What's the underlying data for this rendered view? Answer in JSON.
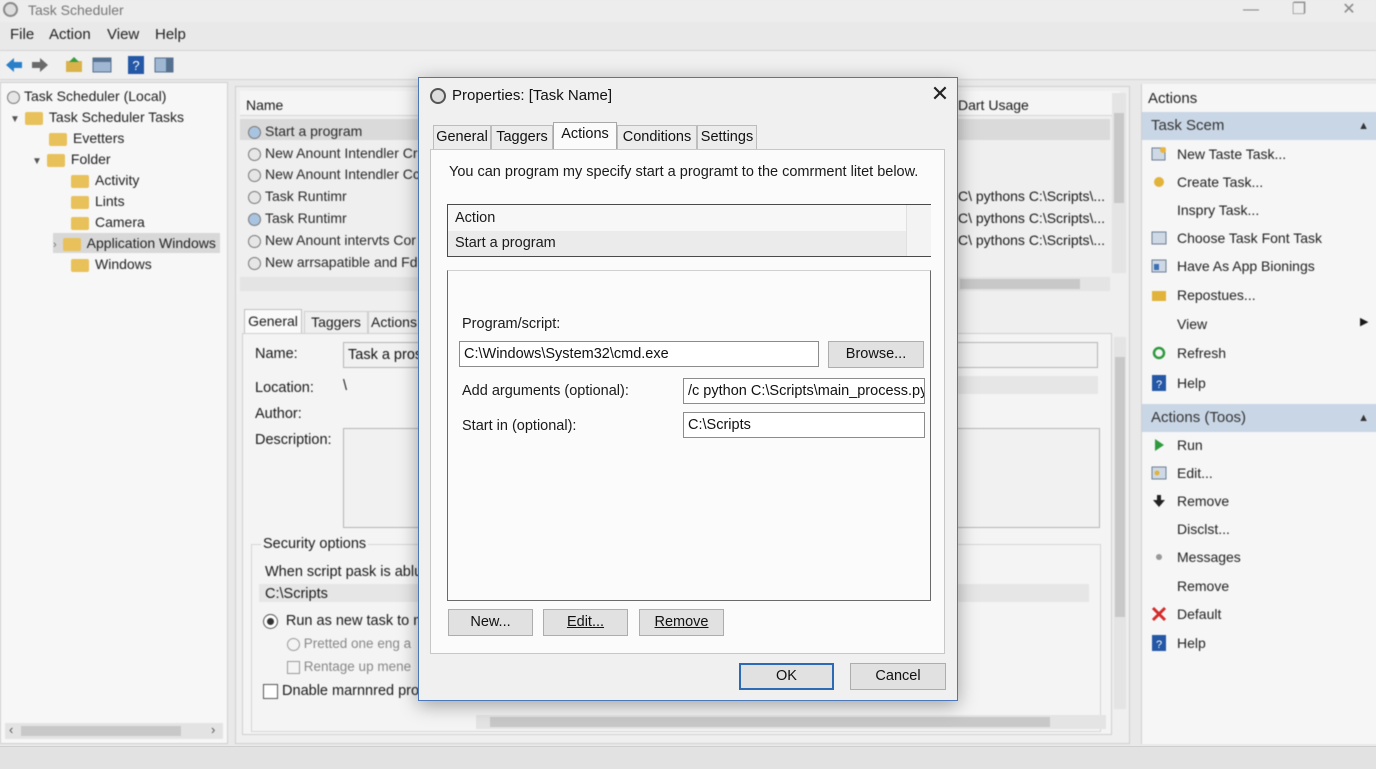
{
  "window": {
    "title": "Task Scheduler",
    "controls": [
      "—",
      "❐",
      "✕"
    ]
  },
  "menu": [
    "File",
    "Action",
    "View",
    "Help"
  ],
  "tree": {
    "root": "Task Scheduler (Local)",
    "library": "Task Scheduler Tasks",
    "items": [
      "Evetters",
      "Folder",
      "Activity",
      "Lints",
      "Camera",
      "Application Windows",
      "Windows"
    ]
  },
  "task_list": {
    "col_name": "Name",
    "col_last": "Dart Usage",
    "rows": [
      {
        "name": "Start a program",
        "action": ""
      },
      {
        "name": "New Anount Intendler Cr",
        "action": ""
      },
      {
        "name": "New Anount Intendler Cc",
        "action": ""
      },
      {
        "name": "Task Runtimr",
        "action": "C\\ pythons C:\\Scripts\\..."
      },
      {
        "name": "Task Runtimr",
        "action": "C\\ pythons C:\\Scripts\\..."
      },
      {
        "name": "New Anount intervts Cor",
        "action": "C\\ pythons C:\\Scripts\\..."
      },
      {
        "name": "New arrsapatible and Fd",
        "action": ""
      }
    ]
  },
  "detail": {
    "tabs": [
      "General",
      "Taggers",
      "Actions"
    ],
    "name_label": "Name:",
    "name_value": "Task a pros",
    "location_label": "Location:",
    "location_value": "\\",
    "author_label": "Author:",
    "description_label": "Description:",
    "security_title": "Security options",
    "security_line": "When script pask is ablu",
    "security_path": "C:\\Scripts",
    "run_option": "Run as new task to m",
    "sub_option_1": "Pretted one eng a",
    "sub_option_2": "Rentage up mene",
    "enable_option": "Dnable marnnred pro"
  },
  "actions_pane": {
    "header": "Actions",
    "section1": "Task Scem",
    "items1": [
      "New Taste Task...",
      "Create Task...",
      "Inspry Task...",
      "Choose Task Font Task",
      "Have As App Bionings",
      "Repostues...",
      "View",
      "Refresh",
      "Help"
    ],
    "section2": "Actions (Toos)",
    "items2": [
      "Run",
      "Edit...",
      "Remove",
      "Disclst...",
      "Messages",
      "Remove",
      "Default",
      "Help"
    ]
  },
  "dialog": {
    "title": "Properties: [Task Name]",
    "close": "✕",
    "tabs": [
      "General",
      "Taggers",
      "Actions",
      "Conditions",
      "Settings"
    ],
    "active_tab": "Actions",
    "intro": "You can program my specify start a programt to the comrment litet below.",
    "list_header": "Action",
    "list_row": "Start a program",
    "program_label": "Program/script:",
    "program_value": "C:\\Windows\\System32\\cmd.exe",
    "browse": "Browse...",
    "args_label": "Add arguments (optional):",
    "args_value": "/c python C:\\Scripts\\main_process.py",
    "startin_label": "Start in (optional):",
    "startin_value": "C:\\Scripts",
    "btn_new": "New...",
    "btn_edit": "Edit...",
    "btn_remove": "Remove",
    "ok": "OK",
    "cancel": "Cancel"
  }
}
